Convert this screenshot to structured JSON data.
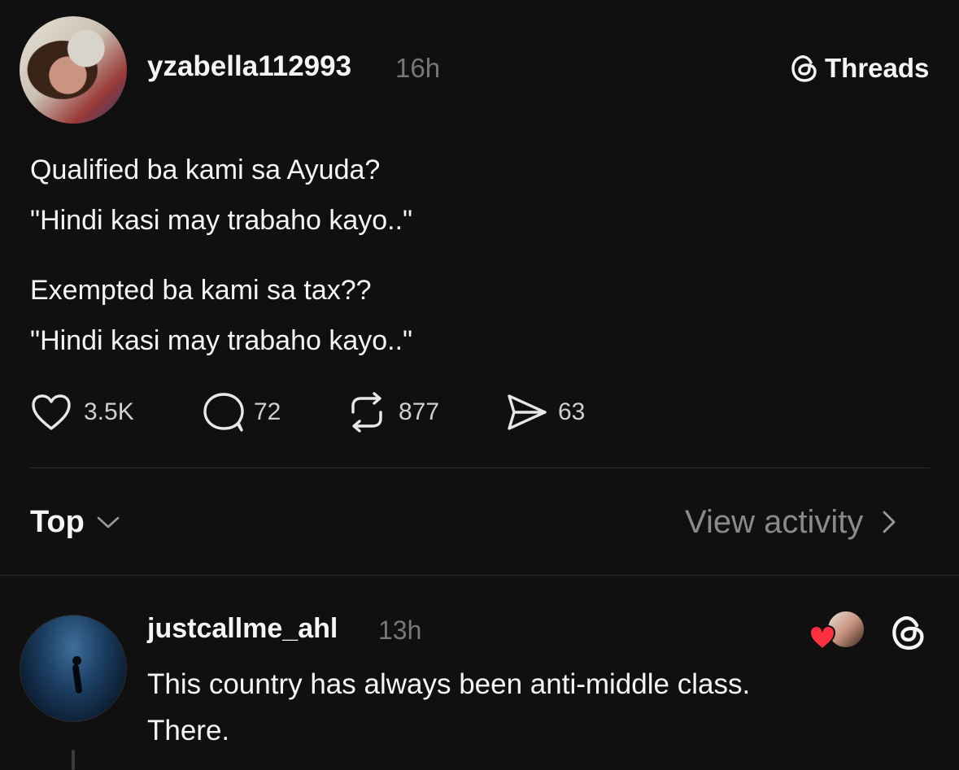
{
  "post": {
    "username": "yzabella112993",
    "time": "16h",
    "brand": "Threads",
    "lines": [
      "Qualified ba kami sa Ayuda?",
      "\"Hindi kasi may trabaho kayo..\"",
      "Exempted ba kami sa tax??",
      "\"Hindi kasi may trabaho kayo..\""
    ],
    "stats": {
      "likes": "3.5K",
      "replies": "72",
      "reposts": "877",
      "shares": "63"
    }
  },
  "sort": {
    "label": "Top",
    "view_activity": "View activity"
  },
  "reply": {
    "username": "justcallme_ahl",
    "time": "13h",
    "lines": [
      "This country has always been anti-middle class.",
      "There."
    ]
  },
  "colors": {
    "background": "#101010",
    "text": "#f3f5f7",
    "muted": "#777777",
    "like_heart": "#ff3040"
  },
  "icons": [
    "heart-icon",
    "comment-icon",
    "repost-icon",
    "share-icon",
    "chevron-down-icon",
    "chevron-right-icon",
    "threads-logo-icon"
  ]
}
